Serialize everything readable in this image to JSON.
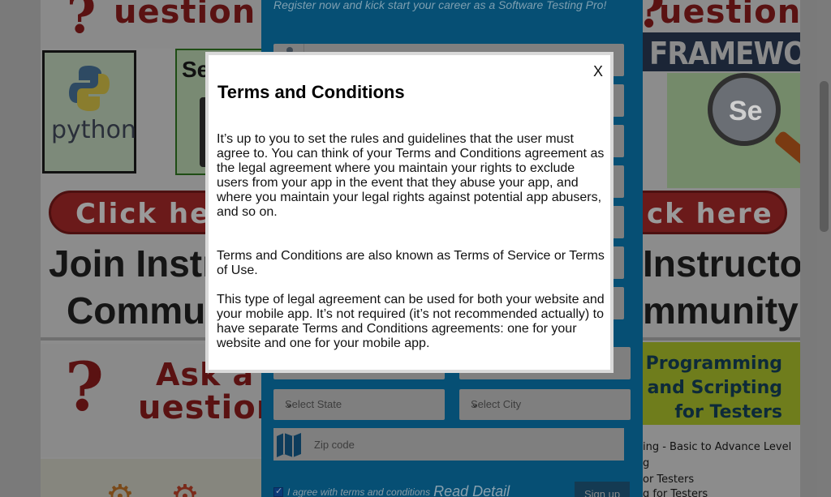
{
  "background": {
    "left": {
      "ask_top": "uestion",
      "python_text": "python",
      "selenium_prefix": "Se",
      "click_label": "Click he",
      "join_line1": "Join Instru",
      "join_line2": "Commun",
      "ask_bottom_a": "Ask a",
      "ask_bottom_b": "uestion"
    },
    "right": {
      "question_top": "uestion",
      "framework": "FRAMEWORK",
      "se_logo": "Se",
      "click_label": "ck here",
      "instructor_line1": "Instructor",
      "instructor_line2": "mmunity",
      "programming_title": "Programming and Scripting for Testers",
      "list_items": [
        "ing - Basic to Advance Level",
        "g",
        "or Testers",
        "g for Testers"
      ]
    }
  },
  "form": {
    "headline": "Register now and kick start your career as a Software Testing Pro!",
    "state_placeholder": "Select State",
    "city_placeholder": "Select City",
    "zip_placeholder": "Zip code",
    "agree_text": "I agree with terms and conditions",
    "read_detail": "Read Detail",
    "signup_label": "Sign up"
  },
  "modal": {
    "close_label": "X",
    "title": "Terms and Conditions",
    "paragraph1": "It’s up to you to set the rules and guidelines that the user must agree to. You can think of your Terms and Conditions agreement as the legal agreement where you maintain your rights to exclude users from your app in the event that they abuse your app, and where you maintain your legal rights against potential app abusers, and so on.",
    "paragraph2": "Terms and Conditions are also known as Terms of Service or Terms of Use.",
    "paragraph3": "This type of legal agreement can be used for both your website and your mobile app. It’s not required (it’s not recommended actually) to have separate Terms and Conditions agreements: one for your website and one for your mobile app."
  },
  "colors": {
    "overlay_tint": "#808080",
    "form_panel": "#064f74",
    "modal_bg": "#ffffff"
  },
  "icons": [
    "python-logo-icon",
    "selenium-logo-icon",
    "person-icon",
    "map-icon",
    "chevron-down-icon",
    "checkbox-icon",
    "close-icon"
  ]
}
